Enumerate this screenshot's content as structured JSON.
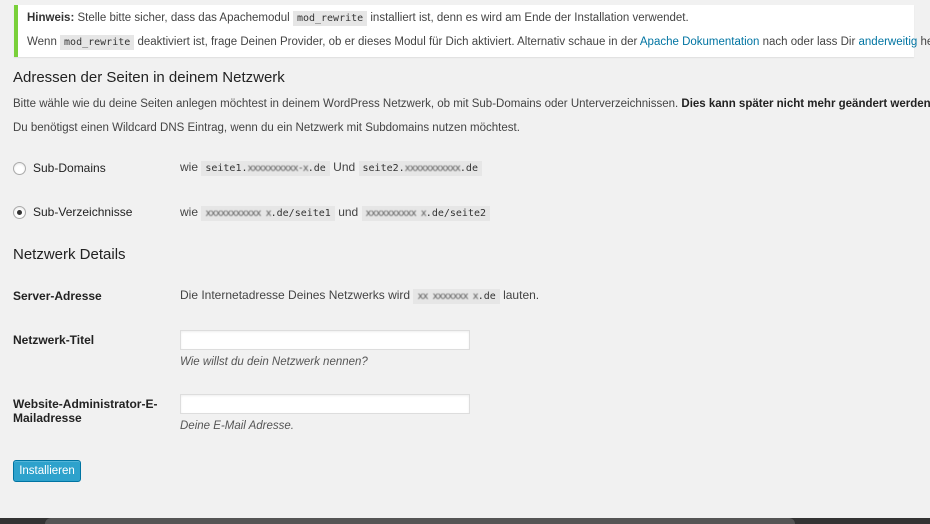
{
  "notice": {
    "label": "Hinweis:",
    "line1_pre": " Stelle bitte sicher, dass das Apachemodul ",
    "line1_code": "mod_rewrite",
    "line1_post": " installiert ist, denn es wird am Ende der Installation verwendet.",
    "line2_pre": "Wenn ",
    "line2_code": "mod_rewrite",
    "line2_mid": " deaktiviert ist, frage Deinen Provider, ob er dieses Modul für Dich aktiviert. Alternativ schaue in der ",
    "link_docs": "Apache Dokumentation",
    "line2_mid2": " nach oder lass Dir ",
    "link_other": "anderweitig",
    "line2_post": " helfen.",
    "border_color": "#7ad03a"
  },
  "addresses": {
    "heading": "Adressen der Seiten in deinem Netzwerk",
    "intro": "Bitte wähle wie du deine Seiten anlegen möchtest in deinem WordPress Netzwerk, ob mit Sub-Domains oder Unterverzeichnissen. ",
    "intro_bold": "Dies kann später nicht mehr geändert werden!",
    "dns_note": "Du benötigst einen Wildcard DNS Eintrag, wenn du ein Netzwerk mit Subdomains nutzen möchtest.",
    "options": [
      {
        "label": "Sub-Domains",
        "checked": false,
        "wie": "wie ",
        "ex1": "seite1.",
        "ex1_blur": "xxxxxxxxxx-x",
        "ex1_end": ".de",
        "conj": " Und ",
        "ex2": "seite2.",
        "ex2_blur": "xxxxxxxxxxx",
        "ex2_end": ".de"
      },
      {
        "label": "Sub-Verzeichnisse",
        "checked": true,
        "wie": "wie ",
        "ex1_blur": "xxxxxxxxxxx x",
        "ex1_end": ".de/seite1",
        "conj": " und ",
        "ex2_blur": "xxxxxxxxxx x",
        "ex2_end": ".de/seite2"
      }
    ]
  },
  "details": {
    "heading": "Netzwerk Details",
    "server_label": "Server-Adresse",
    "server_pre": "Die Internetadresse Deines Netzwerks wird ",
    "server_blur": "xx xxxxxxx x",
    "server_end": ".de",
    "server_post": " lauten.",
    "title_label": "Netzwerk-Titel",
    "title_value": "",
    "title_desc": "Wie willst du dein Netzwerk nennen?",
    "email_label": "Website-Administrator-E-Mailadresse",
    "email_value": "",
    "email_desc": "Deine E-Mail Adresse."
  },
  "submit_label": "Installieren",
  "colors": {
    "accent": "#2ea2cc",
    "link": "#0074a2",
    "background": "#f1f1f1"
  }
}
